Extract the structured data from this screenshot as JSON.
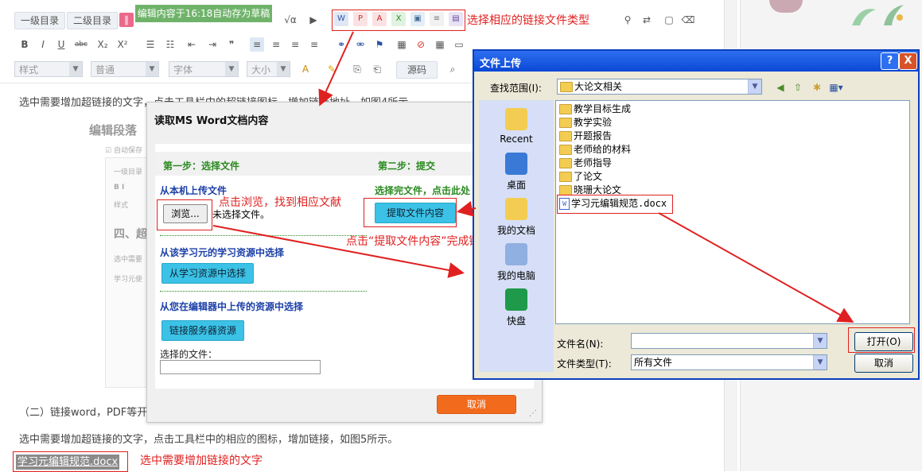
{
  "editor": {
    "toolbar": {
      "heading1": "一级目录",
      "heading2": "二级目录",
      "autosave_tooltip": "编辑内容于16:18自动存为草稿",
      "style_combo": "样式",
      "paragraph_combo": "普通",
      "font_combo": "字体",
      "size_combo": "大小",
      "source_button": "源码",
      "bold": "B",
      "italic": "I",
      "underline": "U",
      "subscript": "X₂",
      "superscript": "X²"
    },
    "body": {
      "para_intro": "选中需要增加超链接的文字，点击工具栏中的超链接图标，增加链接地址，如图4所示。",
      "section_title": "（二）链接word，PDF等开",
      "para_step": "选中需要增加超链接的文字，点击工具栏中的相应的图标，增加链接，如图5所示。",
      "selected_link": "学习元编辑规范.docx"
    },
    "embedded_preview": {
      "title": "编辑段落",
      "autosave": "自动保存",
      "heading_fragment": "四、超",
      "line1": "选中需要",
      "line2": "学习元使",
      "toolbar_label": "一级目录",
      "combo_label": "样式"
    }
  },
  "annotations": {
    "choose_type": "选择相应的链接文件类型",
    "click_browse": "点击浏览，找到相应文献",
    "click_extract": "点击“提取文件内容”完成链接",
    "select_text": "选中需要增加链接的文字"
  },
  "word_dialog": {
    "title": "读取MS Word文档内容",
    "step1": "第一步：选择文件",
    "step2": "第二步：提交",
    "upload_local": "从本机上传文件",
    "browse_button": "浏览...",
    "no_file": "未选择文件。",
    "after_select": "选择完文件，点击此处",
    "extract_button": "提取文件内容",
    "from_resources": "从该学习元的学习资源中选择",
    "from_resources_button": "从学习资源中选择",
    "from_uploaded": "从您在编辑器中上传的资源中选择",
    "server_button": "链接服务器资源",
    "selected_file_label": "选择的文件：",
    "selected_file_value": "",
    "cancel_button": "取消"
  },
  "file_dialog": {
    "title": "文件上传",
    "help": "?",
    "close": "X",
    "look_in_label": "查找范围(I):",
    "look_in_value": "大论文相关",
    "places": [
      "Recent",
      "桌面",
      "我的文档",
      "我的电脑",
      "快盘"
    ],
    "files": [
      {
        "name": "教学目标生成",
        "type": "folder"
      },
      {
        "name": "教学实验",
        "type": "folder"
      },
      {
        "name": "开题报告",
        "type": "folder"
      },
      {
        "name": "老师给的材料",
        "type": "folder"
      },
      {
        "name": "老师指导",
        "type": "folder"
      },
      {
        "name": "了论文",
        "type": "folder"
      },
      {
        "name": "晓珊大论文",
        "type": "folder"
      },
      {
        "name": "学习元编辑规范.docx",
        "type": "doc"
      }
    ],
    "filename_label": "文件名(N):",
    "filename_value": "",
    "filetype_label": "文件类型(T):",
    "filetype_value": "所有文件",
    "open_button": "打开(O)",
    "cancel_button": "取消"
  },
  "colors": {
    "annotation_red": "#e02020",
    "xp_blue": "#0a47d6",
    "tooltip_green": "#6fb36a",
    "step_green": "#2a8a1f",
    "cyan_button": "#3bc2e6",
    "orange_button": "#f26b1d"
  }
}
